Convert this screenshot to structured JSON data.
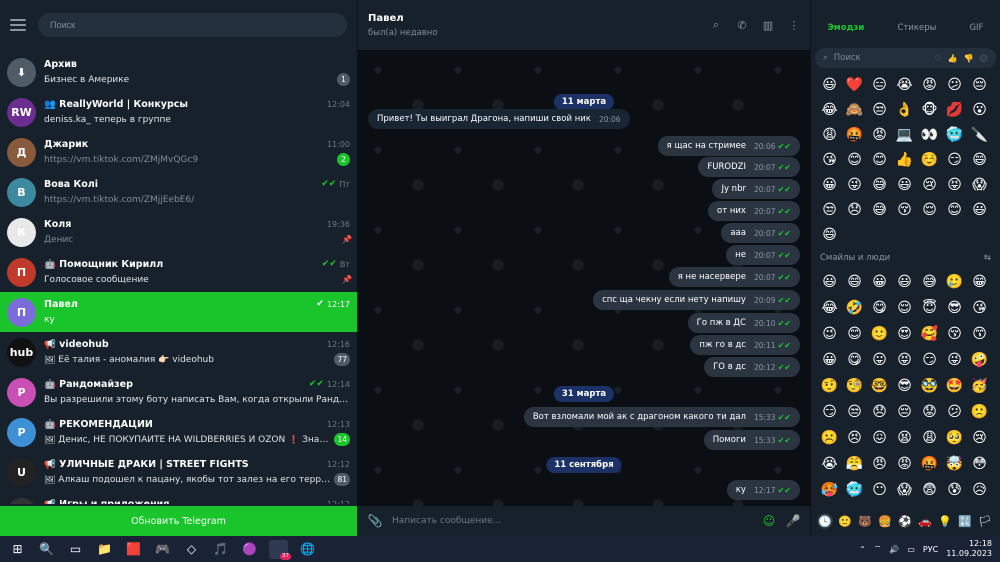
{
  "sidebar": {
    "search_placeholder": "Поиск",
    "update_button": "Обновить Telegram",
    "chats": [
      {
        "name": "Архив",
        "message": "Бизнес в Америке",
        "time": "",
        "badge": "1",
        "badge_color": "grey",
        "avatar_color": "#4f5b66",
        "avatar_text": "⬇",
        "msg_white": true
      },
      {
        "name": "👥 ReallyWorld | Конкурсы",
        "message": "deniss.ka_ теперь в группе",
        "time": "12:04",
        "avatar_color": "#6b2d8f",
        "avatar_text": "RW",
        "msg_white": true
      },
      {
        "name": "Джарик",
        "message": "https://vm.tiktok.com/ZMjMvQGc9",
        "time": "11:00",
        "badge": "2",
        "badge_color": "green",
        "avatar_color": "#8a5a3c",
        "avatar_text": "Д"
      },
      {
        "name": "Вова Колі",
        "message": "https://vm.tiktok.com/ZMjjEebE6/",
        "time": "Пт",
        "check": "✔✔",
        "pinned": false,
        "avatar_color": "#3c8aa0",
        "avatar_text": "В"
      },
      {
        "name": "Коля",
        "message": "Денис",
        "time": "19:36",
        "pinned": true,
        "avatar_color": "#e8e8e8",
        "avatar_text": "К"
      },
      {
        "name": "🤖 Помощник Кирилл",
        "message": "Голосовое сообщение",
        "time": "Вт",
        "check": "✔✔",
        "pinned": true,
        "avatar_color": "#c0392b",
        "avatar_text": "П",
        "msg_white": true
      },
      {
        "name": "Павел",
        "message": "ку",
        "time": "12:17",
        "check": "✔",
        "active": true,
        "avatar_color": "#7b6cd9",
        "avatar_text": "П"
      },
      {
        "name": "📢 videohub",
        "message": "🖼 Её талия - аномалия 👉🏻 videohub",
        "time": "12:16",
        "badge": "77",
        "badge_color": "grey",
        "avatar_color": "#111111",
        "avatar_text": "hub",
        "msg_white": true
      },
      {
        "name": "🤖 Рандомайзер",
        "message": "Вы разрешили этому боту написать Вам, когда открыли Рандомайзер.",
        "time": "12:14",
        "check": "✔✔",
        "avatar_color": "#c94fb5",
        "avatar_text": "Р",
        "msg_white": true
      },
      {
        "name": "🤖 РЕКОМЕНДАЦИИ",
        "message": "🖼 Денис, НЕ ПОКУПАЙТЕ НА WILDBERRIES И OZON ❗ Знающие люд...",
        "time": "12:13",
        "badge": "14",
        "badge_color": "green",
        "avatar_color": "#3d8fd6",
        "avatar_text": "Р",
        "msg_white": true
      },
      {
        "name": "📢 УЛИЧНЫЕ ДРАКИ | STREET FIGHTS",
        "message": "🖼 Алкаш подошел к пацану, якобы тот залез на его территорию...",
        "time": "12:12",
        "badge": "81",
        "badge_color": "grey",
        "avatar_color": "#222222",
        "avatar_text": "U",
        "msg_white": true
      },
      {
        "name": "📢 Игры и приложения",
        "message": "",
        "time": "12:12",
        "avatar_color": "#333333",
        "avatar_text": "И"
      }
    ]
  },
  "chat": {
    "name": "Павел",
    "status": "был(а) недавно",
    "composer_placeholder": "Написать сообщение...",
    "dates": [
      "11 марта",
      "31 марта",
      "11 сентября"
    ],
    "messages": [
      {
        "text": "Привет! Ты выиграл Драгона, напиши свой ник",
        "time": "20:06",
        "dir": "in"
      },
      {
        "text": "я щас на стримее",
        "time": "20:06",
        "dir": "out"
      },
      {
        "text": "FURODZI",
        "time": "20:07",
        "dir": "out"
      },
      {
        "text": "Jy nbr",
        "time": "20:07",
        "dir": "out"
      },
      {
        "text": "от них",
        "time": "20:07",
        "dir": "out"
      },
      {
        "text": "ааа",
        "time": "20:07",
        "dir": "out"
      },
      {
        "text": "не",
        "time": "20:07",
        "dir": "out"
      },
      {
        "text": "я не насервере",
        "time": "20:07",
        "dir": "out"
      },
      {
        "text": "спс ща чекну если нету напишу",
        "time": "20:09",
        "dir": "out"
      },
      {
        "text": "Го пж в ДС",
        "time": "20:10",
        "dir": "out"
      },
      {
        "text": "пж го в дс",
        "time": "20:11",
        "dir": "out"
      },
      {
        "text": "ГО в дс",
        "time": "20:12",
        "dir": "out"
      },
      {
        "text": "Вот взломали мой ак с драгоном какого ти дал",
        "time": "15:33",
        "dir": "out"
      },
      {
        "text": "Помоги",
        "time": "15:33",
        "dir": "out"
      },
      {
        "text": "ку",
        "time": "12:17",
        "dir": "out"
      }
    ]
  },
  "emoji_panel": {
    "tabs": [
      "Эмодзи",
      "Стикеры",
      "GIF"
    ],
    "search": "Поиск",
    "section_label": "Смайлы и люди",
    "recent": [
      "😃",
      "❤️",
      "😑",
      "😭",
      "😡",
      "😕",
      "😔",
      "😂",
      "🙈",
      "😒",
      "👌",
      "🐵",
      "💋",
      "😮",
      "😩",
      "🤬",
      "😡",
      "💻",
      "👀",
      "🥶",
      "🔪",
      "😘",
      "😊",
      "😊",
      "👍",
      "☺️",
      "😏",
      "😄",
      "😀",
      "😜",
      "😅",
      "😃",
      "😢",
      "😝",
      "😱",
      "😒",
      "😞",
      "😅",
      "😚",
      "😌",
      "😊",
      "😃",
      "😄"
    ],
    "people": [
      "😃",
      "😄",
      "😀",
      "😃",
      "😅",
      "🥲",
      "😁",
      "😂",
      "🤣",
      "😋",
      "😌",
      "😇",
      "😎",
      "😘",
      "😉",
      "😊",
      "🙂",
      "😍",
      "🥰",
      "😚",
      "😙",
      "😀",
      "😋",
      "😛",
      "😝",
      "😏",
      "😜",
      "🤪",
      "🤨",
      "🧐",
      "🤓",
      "😎",
      "🥸",
      "🤩",
      "🥳",
      "😏",
      "😒",
      "😞",
      "😔",
      "😟",
      "😕",
      "🙁",
      "☹️",
      "😣",
      "😖",
      "😫",
      "😩",
      "🥺",
      "😢",
      "😭",
      "😤",
      "😠",
      "😡",
      "🤬",
      "🤯",
      "😳",
      "🥵",
      "🥶",
      "😶",
      "😱",
      "😨",
      "😰",
      "😥"
    ],
    "categories": [
      "🕓",
      "🙂",
      "🐻",
      "🍔",
      "⚽",
      "🚗",
      "💡",
      "🔣",
      "🏳"
    ]
  },
  "taskbar": {
    "apps": [
      "⊞",
      "🔍",
      "▭",
      "📁",
      "🟥",
      "🎮",
      "◇",
      "🎵",
      "🟣",
      "✈",
      "🌐"
    ],
    "telegram_badge": "37",
    "lang": "РУС",
    "time": "12:18",
    "date": "11.09.2023"
  },
  "colors": {
    "accent": "#19c52b",
    "date_pill": "#1c3266"
  }
}
